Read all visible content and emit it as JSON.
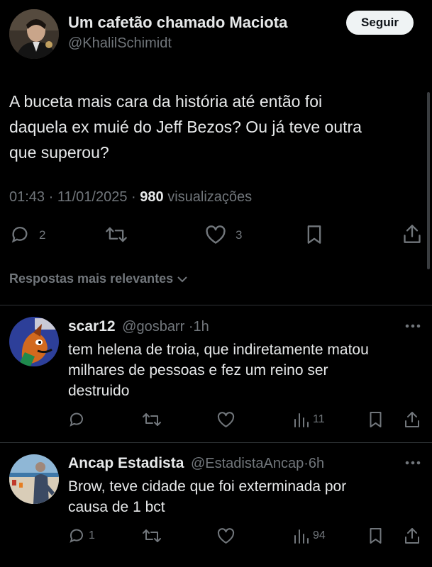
{
  "post": {
    "author_name": "Um cafetão chamado Maciota",
    "author_handle": "@KhalilSchimidt",
    "follow_label": "Seguir",
    "text_lines": [
      "A buceta mais cara da história até então foi",
      "daquela ex muié do Jeff Bezos? Ou já teve outra",
      "que superou?"
    ],
    "time": "01:43",
    "date": "11/01/2025",
    "views_count": "980",
    "views_label": "visualizações",
    "replies": "2",
    "likes": "3"
  },
  "replies_header": {
    "label": "Respostas mais relevantes"
  },
  "replies": [
    {
      "name": "scar12",
      "handle": "@gosbarr",
      "age": "1h",
      "text_lines": [
        "tem helena de troia, que indiretamente matou",
        "milhares de pessoas e fez um reino ser",
        "destruido"
      ],
      "reply_count": "",
      "views": "11"
    },
    {
      "name": "Ancap Estadista",
      "handle": "@EstadistaAncap",
      "age": "6h",
      "text_lines": [
        "Brow, teve cidade que foi exterminada por",
        "causa de 1 bct"
      ],
      "reply_count": "1",
      "views": "94"
    }
  ],
  "colors": {
    "background": "#000000",
    "text": "#e7e9ea",
    "muted": "#71767b",
    "divider": "#2f3336",
    "button_bg": "#eff3f4"
  }
}
